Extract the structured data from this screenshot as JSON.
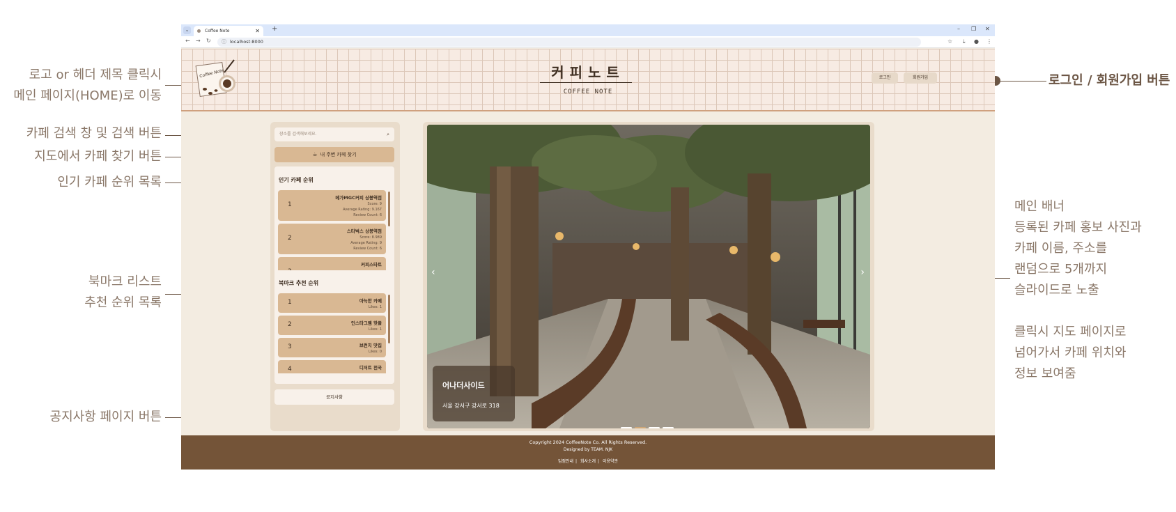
{
  "annotations": {
    "logo": [
      "로고 or 헤더 제목 클릭시",
      "메인 페이지(HOME)로 이동"
    ],
    "search": "카페 검색 창 및 검색 버튼",
    "map": "지도에서 카페 찾기 버튼",
    "popular": "인기 카페 순위 목록",
    "bookmark": [
      "북마크 리스트",
      "추천 순위 목록"
    ],
    "notice": "공지사항 페이지 버튼",
    "login": "로그인 / 회원가입 버튼",
    "banner": [
      "메인 배너",
      "등록된 카페 홍보 사진과",
      "카페 이름, 주소를",
      "랜덤으로 5개까지",
      "슬라이드로 노출"
    ],
    "banner_click": [
      "클릭시 지도 페이지로",
      "넘어가서 카페 위치와",
      "정보 보여줌"
    ]
  },
  "browser": {
    "tab_title": "Coffee Note",
    "url": "localhost:8000"
  },
  "header": {
    "logo_text": "Coffee Note",
    "title_kr": "커피노트",
    "title_en": "COFFEE NOTE",
    "login_label": "로그인",
    "signup_label": "회원가입"
  },
  "sidebar": {
    "search_placeholder": "장소를 검색해보세요.",
    "map_button": "내 주변 카페 찾기",
    "popular_title": "인기 카페 순위",
    "popular": [
      {
        "rank": "1",
        "name": "메가MGC커피 상봉역점",
        "score": "Score: 9",
        "avg": "Average Rating: 9.167",
        "reviews": "Review Count: 6"
      },
      {
        "rank": "2",
        "name": "스타벅스 상봉역점",
        "score": "Score: 8.989",
        "avg": "Average Rating: 9",
        "reviews": "Review Count: 6"
      },
      {
        "rank": "3",
        "name": "커피스타트"
      }
    ],
    "bookmark_title": "북마크 추천 순위",
    "bookmarks": [
      {
        "rank": "1",
        "name": "아늑한 카페",
        "likes": "Likes: 1"
      },
      {
        "rank": "2",
        "name": "인스타그램 핫플",
        "likes": "Likes: 1"
      },
      {
        "rank": "3",
        "name": "브런치 맛집",
        "likes": "Likes: 0"
      },
      {
        "rank": "4",
        "name": "디저트 천국"
      }
    ],
    "notice_button": "공지사항"
  },
  "banner": {
    "cafe_name": "어나더사이드",
    "address": "서울 강서구 강서로 318",
    "prev": "‹",
    "next": "›",
    "slide_count": 4,
    "active_slide": 2
  },
  "footer": {
    "copyright": "Copyright 2024 CoffeeNote Co. All Rights Reserved.",
    "designed": "Designed by TEAM. NJK",
    "links": [
      "입점안내",
      "회사소개",
      "이용약관"
    ]
  }
}
